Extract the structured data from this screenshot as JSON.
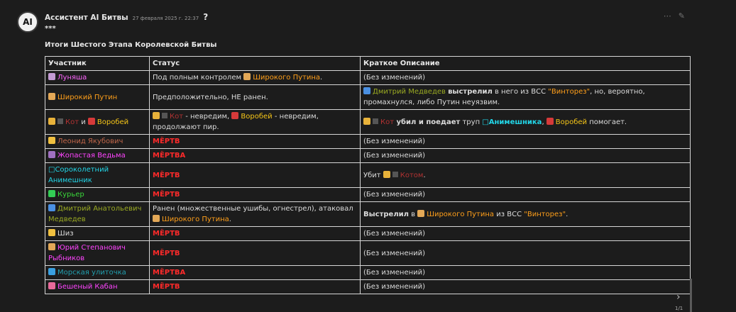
{
  "message": {
    "avatar_text": "AI",
    "author": "Ассистент AI Битвы",
    "timestamp": "27 февраля 2025 г. 22:37",
    "question_mark": "?",
    "stars": "***",
    "title": "Итоги Шестого Этапа Королевской Битвы",
    "icons": [
      "more-icon",
      "edit-icon"
    ]
  },
  "table": {
    "headers": [
      "Участник",
      "Статус",
      "Краткое Описание"
    ],
    "rows": [
      {
        "participant": [
          {
            "emoji": "#c39bd3"
          },
          {
            "text": "Луняша",
            "color": "#ff66ff"
          }
        ],
        "status": [
          {
            "text": "Под полным контролем "
          },
          {
            "emoji": "#e3a857"
          },
          {
            "text": "Широкого Путина",
            "color": "#ff9f1a"
          },
          {
            "text": "."
          }
        ],
        "desc": [
          {
            "text": "(Без изменений)"
          }
        ]
      },
      {
        "participant": [
          {
            "emoji": "#e3a857"
          },
          {
            "text": "Широкий Путин",
            "color": "#ff9f1a"
          }
        ],
        "status": [
          {
            "text": "Предположительно, НЕ ранен."
          }
        ],
        "desc": [
          {
            "emoji": "#4a90e2"
          },
          {
            "text": "Дмитрий Медведев ",
            "color": "#9aaa22"
          },
          {
            "text": "выстрелил",
            "bold": true
          },
          {
            "text": " в него из ВСС "
          },
          {
            "text": "\"Винторез\"",
            "color": "#ff9f1a"
          },
          {
            "text": ", но, вероятно, промахнулся, либо Путин неуязвим."
          }
        ]
      },
      {
        "participant": [
          {
            "emoji": "#e8b23a"
          },
          {
            "sq": true
          },
          {
            "text": "Кот",
            "color": "#b23232"
          },
          {
            "text": " и "
          },
          {
            "emoji": "#d63a3a"
          },
          {
            "text": "Воробей",
            "color": "#f5c518"
          }
        ],
        "status": [
          {
            "emoji": "#e8b23a"
          },
          {
            "sq": true
          },
          {
            "text": "Кот",
            "color": "#b23232"
          },
          {
            "text": " - невредим, "
          },
          {
            "emoji": "#d63a3a"
          },
          {
            "text": "Воробей",
            "color": "#f5c518"
          },
          {
            "text": " - невредим, продолжают пир."
          }
        ],
        "desc": [
          {
            "emoji": "#e8b23a"
          },
          {
            "sq": true
          },
          {
            "text": "Кот",
            "color": "#b23232"
          },
          {
            "text": " убил и поедает",
            "bold": true
          },
          {
            "text": " труп "
          },
          {
            "text": "□Анимешника",
            "color": "#22d6e8",
            "bold": true
          },
          {
            "text": ", "
          },
          {
            "emoji": "#d63a3a"
          },
          {
            "text": "Воробей",
            "color": "#f5c518"
          },
          {
            "text": " помогает."
          }
        ]
      },
      {
        "participant": [
          {
            "emoji": "#f0c040"
          },
          {
            "text": "Леонид Якубович",
            "color": "#c0664a"
          }
        ],
        "status": [
          {
            "text": "МЁРТВ",
            "dead": true
          }
        ],
        "desc": [
          {
            "text": "(Без изменений)"
          }
        ]
      },
      {
        "participant": [
          {
            "emoji": "#a070c0"
          },
          {
            "text": "Жопастая Ведьма",
            "color": "#ff44ff"
          }
        ],
        "status": [
          {
            "text": "МЁРТВА",
            "dead": true
          }
        ],
        "desc": [
          {
            "text": "(Без изменений)"
          }
        ]
      },
      {
        "participant": [
          {
            "text": "□Сороколетний Анимешник",
            "color": "#22d6e8"
          }
        ],
        "status": [
          {
            "text": "МЁРТВ",
            "dead": true
          }
        ],
        "desc": [
          {
            "text": "Убит "
          },
          {
            "emoji": "#e8b23a"
          },
          {
            "sq": true
          },
          {
            "text": "Котом",
            "color": "#b23232"
          },
          {
            "text": "."
          }
        ]
      },
      {
        "participant": [
          {
            "emoji": "#33cc55"
          },
          {
            "text": "Курьер",
            "color": "#3ad63a"
          }
        ],
        "status": [
          {
            "text": "МЁРТВ",
            "dead": true
          }
        ],
        "desc": [
          {
            "text": "(Без изменений)"
          }
        ]
      },
      {
        "participant": [
          {
            "emoji": "#4a90e2"
          },
          {
            "text": "Дмитрий Анатольевич Медведев",
            "color": "#9aaa22"
          }
        ],
        "status": [
          {
            "text": "Ранен (множественные ушибы, огнестрел), атаковал "
          },
          {
            "emoji": "#e3a857"
          },
          {
            "text": "Широкого Путина",
            "color": "#ff9f1a"
          },
          {
            "text": "."
          }
        ],
        "desc": [
          {
            "text": "Выстрелил",
            "bold": true
          },
          {
            "text": " в "
          },
          {
            "emoji": "#e3a857"
          },
          {
            "text": "Широкого Путина",
            "color": "#ff9f1a"
          },
          {
            "text": " из ВСС "
          },
          {
            "text": "\"Винторез\"",
            "color": "#ff9f1a"
          },
          {
            "text": "."
          }
        ]
      },
      {
        "participant": [
          {
            "emoji": "#f0c040"
          },
          {
            "text": "Шиз"
          }
        ],
        "status": [
          {
            "text": "МЁРТВ",
            "dead": true
          }
        ],
        "desc": [
          {
            "text": "(Без изменений)"
          }
        ]
      },
      {
        "participant": [
          {
            "emoji": "#e3a857"
          },
          {
            "text": "Юрий Степанович Рыбников",
            "color": "#ff44ff"
          }
        ],
        "status": [
          {
            "text": "МЁРТВ",
            "dead": true
          }
        ],
        "desc": [
          {
            "text": "(Без изменений)"
          }
        ]
      },
      {
        "participant": [
          {
            "emoji": "#3aa0e0"
          },
          {
            "text": "Морская улиточка",
            "color": "#22a0b0"
          }
        ],
        "status": [
          {
            "text": "МЁРТВА",
            "dead": true
          }
        ],
        "desc": [
          {
            "text": "(Без изменений)"
          }
        ]
      },
      {
        "participant": [
          {
            "emoji": "#e86a9a"
          },
          {
            "text": "Бешеный Кабан",
            "color": "#ff44ff"
          }
        ],
        "status": [
          {
            "text": "МЁРТВ",
            "dead": true
          }
        ],
        "desc": [
          {
            "text": "(Без изменений)"
          }
        ]
      }
    ]
  },
  "pager": {
    "next_icon": "chevron-right-icon",
    "count": "1/1"
  }
}
